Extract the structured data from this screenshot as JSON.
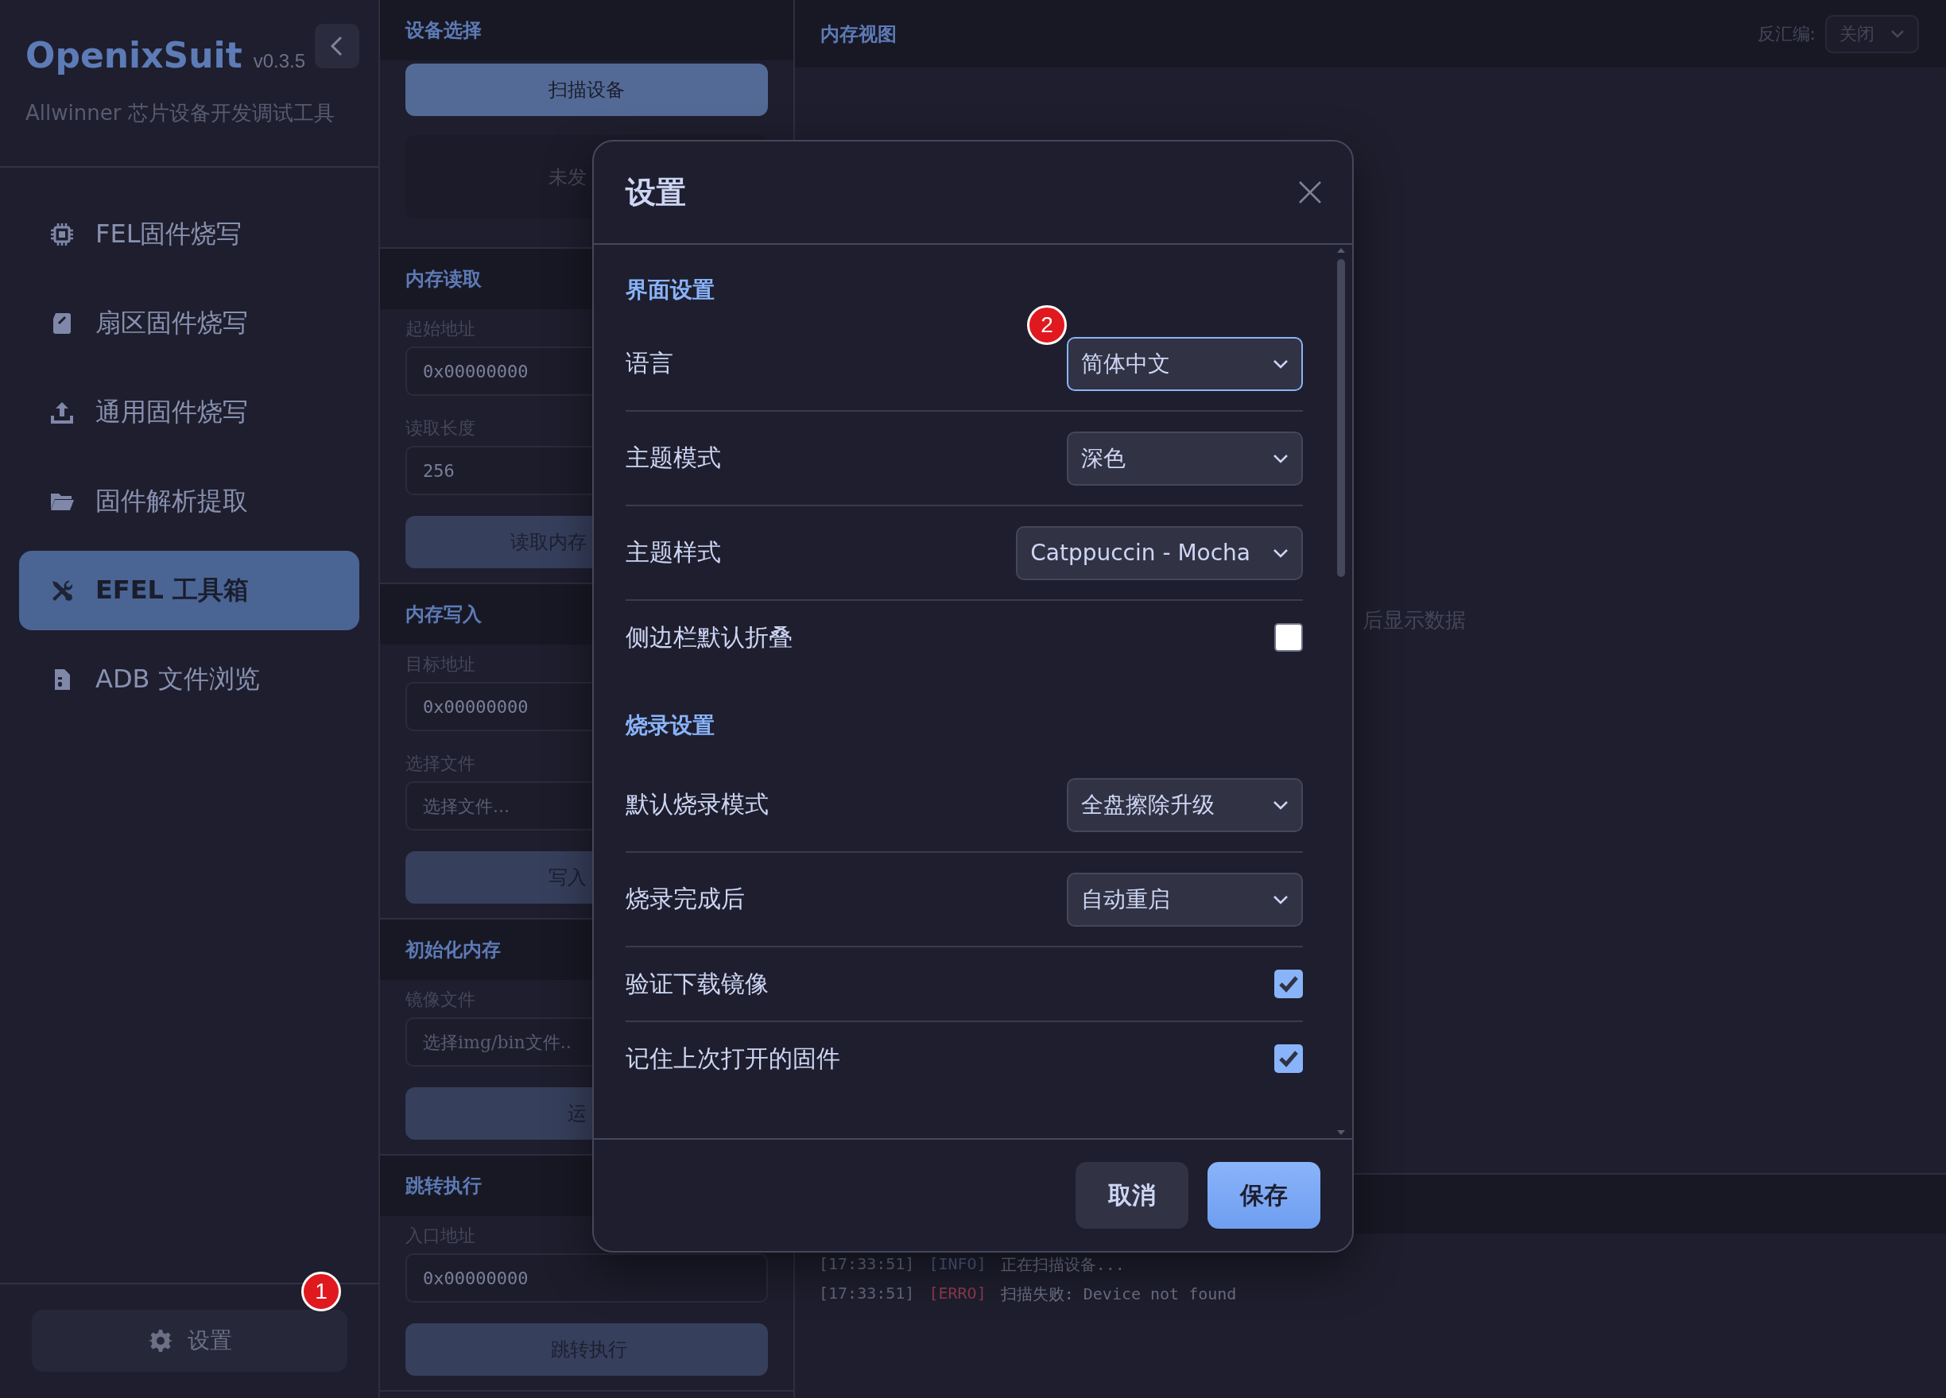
{
  "sidebar": {
    "app_name": "OpenixSuit",
    "version": "v0.3.5",
    "subtitle": "Allwinner 芯片设备开发调试工具",
    "nav": [
      {
        "label": "FEL固件烧写",
        "selected": false
      },
      {
        "label": "扇区固件烧写",
        "selected": false
      },
      {
        "label": "通用固件烧写",
        "selected": false
      },
      {
        "label": "固件解析提取",
        "selected": false
      },
      {
        "label": "EFEL 工具箱",
        "selected": true
      },
      {
        "label": "ADB 文件浏览",
        "selected": false
      }
    ],
    "settings_button": "设置",
    "settings_marker": "1"
  },
  "device_panel": {
    "title": "设备选择",
    "scan_button": "扫描设备",
    "empty_text": "未发",
    "sections": [
      {
        "title": "内存读取",
        "fields": [
          {
            "label": "起始地址",
            "value": "0x00000000"
          },
          {
            "label": "读取长度",
            "value": "256"
          }
        ],
        "button": "读取内存"
      },
      {
        "title": "内存写入",
        "fields": [
          {
            "label": "目标地址",
            "value": "0x00000000"
          },
          {
            "label": "选择文件",
            "placeholder": "选择文件..."
          }
        ],
        "button": "写入"
      },
      {
        "title": "初始化内存",
        "fields": [
          {
            "label": "镜像文件",
            "placeholder": "选择img/bin文件.."
          }
        ],
        "button": "运"
      },
      {
        "title": "跳转执行",
        "fields": [
          {
            "label": "入口地址",
            "value": "0x00000000"
          }
        ],
        "button": "跳转执行"
      }
    ]
  },
  "memory_view": {
    "title": "内存视图",
    "disasm_label": "反汇编:",
    "disasm_value": "关闭",
    "empty_text": "后显示数据",
    "log": [
      {
        "time": "[17:33:51]",
        "level": "[INFO]",
        "kind": "info",
        "text": "正在扫描设备..."
      },
      {
        "time": "[17:33:51]",
        "level": "[ERRO]",
        "kind": "error",
        "text": "扫描失败: Device not found"
      }
    ]
  },
  "dialog": {
    "title": "设置",
    "sections": [
      {
        "title": "界面设置",
        "rows": [
          {
            "label": "语言",
            "kind": "select",
            "value": "简体中文",
            "focused": true,
            "marker": "2"
          },
          {
            "label": "主题模式",
            "kind": "select",
            "value": "深色",
            "focused": false
          },
          {
            "label": "主题样式",
            "kind": "select",
            "value": "Catppuccin - Mocha",
            "focused": false
          },
          {
            "label": "侧边栏默认折叠",
            "kind": "checkbox",
            "checked": false
          }
        ]
      },
      {
        "title": "烧录设置",
        "rows": [
          {
            "label": "默认烧录模式",
            "kind": "select",
            "value": "全盘擦除升级",
            "focused": false
          },
          {
            "label": "烧录完成后",
            "kind": "select",
            "value": "自动重启",
            "focused": false
          },
          {
            "label": "验证下载镜像",
            "kind": "checkbox",
            "checked": true
          },
          {
            "label": "记住上次打开的固件",
            "kind": "checkbox",
            "checked": true
          }
        ]
      }
    ],
    "buttons": [
      {
        "label": "取消",
        "kind": "secondary"
      },
      {
        "label": "保存",
        "kind": "primary"
      }
    ]
  }
}
